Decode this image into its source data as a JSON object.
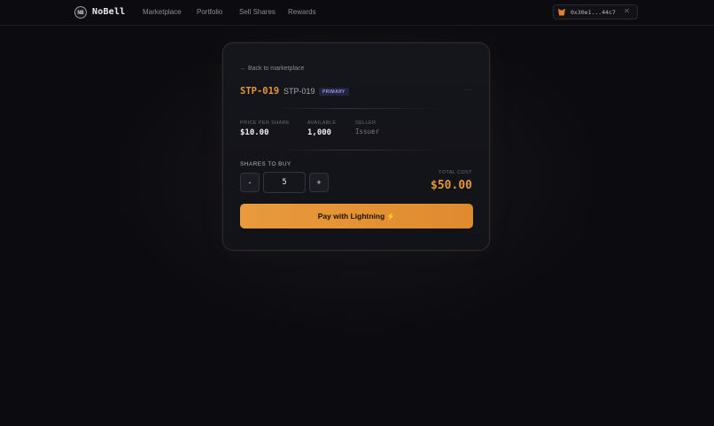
{
  "brand": {
    "logo_text": "NB",
    "name": "NoBell"
  },
  "nav": {
    "items": [
      {
        "label": "Marketplace"
      },
      {
        "label": "Portfolio"
      },
      {
        "label": "Sell Shares"
      },
      {
        "label": "Rewards"
      }
    ]
  },
  "wallet": {
    "address": "0x30e1...44c7",
    "icon": "metamask-fox-icon",
    "close_icon": "close-icon"
  },
  "card": {
    "back_label": "← Back to marketplace",
    "asset_code": "STP-019",
    "asset_name": "STP-019",
    "badge": "PRIMARY",
    "more": "···",
    "stats": [
      {
        "label": "PRICE PER SHARE",
        "value": "$10.00"
      },
      {
        "label": "AVAILABLE",
        "value": "1,000"
      },
      {
        "label": "SELLER",
        "value": "Issuer"
      }
    ],
    "shares_label": "SHARES TO BUY",
    "decrement_label": "-",
    "increment_label": "+",
    "quantity": "5",
    "total_label": "TOTAL COST",
    "total_value": "$50.00",
    "pay_label": "Pay with Lightning",
    "pay_icon": "⚡"
  },
  "colors": {
    "accent": "#e8953a",
    "badge": "#9b96e8",
    "background": "#0c0c10"
  }
}
